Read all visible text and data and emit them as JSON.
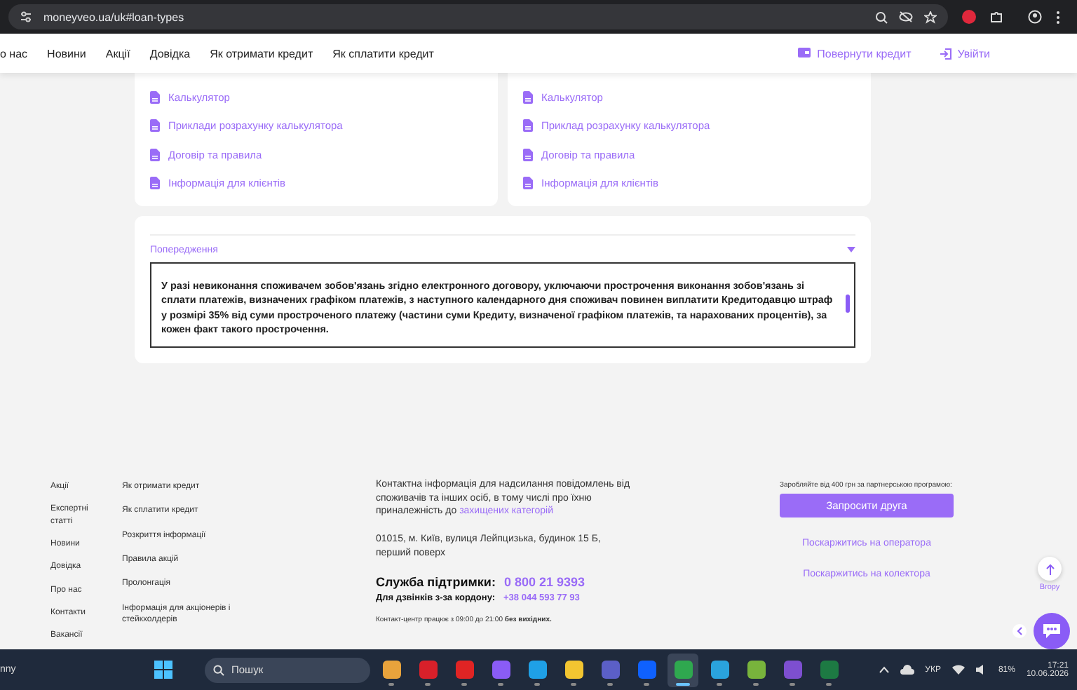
{
  "browser": {
    "url": "moneyveo.ua/uk#loan-types"
  },
  "nav": {
    "items": [
      "о нас",
      "Новини",
      "Акції",
      "Довідка",
      "Як отримати кредит",
      "Як сплатити кредит"
    ],
    "repay": "Повернути кредит",
    "login": "Увійти"
  },
  "cards": [
    {
      "links": [
        "Калькулятор",
        "Приклади розрахунку калькулятора",
        "Договір та правила",
        "Інформація для клієнтів"
      ]
    },
    {
      "links": [
        "Калькулятор",
        "Приклад розрахунку калькулятора",
        "Договір та правила",
        "Інформація для клієнтів"
      ]
    }
  ],
  "warning": {
    "title": "Попередження",
    "expanded": true,
    "text": "У разі невиконання споживачем зобов'язань згідно електронного договору, уключаючи прострочення виконання зобов'язань зі сплати платежів, визначених графіком платежів, з наступного календарного дня споживач повинен виплатити Кредитодавцю штраф у розмірі 35% від суми простроченого платежу (частини суми Кредиту, визначеної графіком платежів, та нарахованих процентів), за кожен факт такого прострочення."
  },
  "footer": {
    "column_1": [
      "Акції",
      "Експертні статті",
      "Новини",
      "Довідка",
      "Про нас",
      "Контакти",
      "Вакансії"
    ],
    "column_2": [
      "Як отримати кредит",
      "Як сплатити кредит",
      "Розкриття інформації",
      "Правила акцій",
      "Пролонгація",
      "Інформація для акціонерів і стейкхолдерів"
    ],
    "contact_text": "Контактна інформація для надсилання повідомлень від споживачів та інших осіб, в тому числі про їхню приналежність до ",
    "contact_link": "захищених категорій",
    "address": "01015, м. Київ, вулиця Лейпцизька, будинок 15 Б, перший поверх",
    "support_label": "Служба підтримки:",
    "support_phone": "0 800 21 9393",
    "abroad_label": "Для дзвінків з-за кордону:",
    "abroad_phone": "+38 044 593 77 93",
    "hours": "Контакт-центр працює з 09:00 до 21:00 **без вихідних.**",
    "partner_text": "Заробляйте від 400 грн за партнерською програмою:",
    "invite": "Запросити друга",
    "complaints": [
      "Поскаржитись на оператора",
      "Поскаржитись на колектора"
    ],
    "up_label": "Вгору"
  },
  "taskbar": {
    "left_text": "nny",
    "search": "Пошук",
    "apps": [
      {
        "color": "#e8a33c",
        "active": false
      },
      {
        "color": "#d8202a",
        "active": false
      },
      {
        "color": "#e02424",
        "active": false
      },
      {
        "color": "#8a5cf6",
        "active": false
      },
      {
        "color": "#1fa0e6",
        "active": false
      },
      {
        "color": "#f2c531",
        "active": false
      },
      {
        "color": "#5b5fc7",
        "active": false
      },
      {
        "color": "#0f61fe",
        "active": false
      },
      {
        "color": "#2fa84f",
        "active": true
      },
      {
        "color": "#2aa3dd",
        "active": false
      },
      {
        "color": "#78b43c",
        "active": false
      },
      {
        "color": "#7d4fd0",
        "active": false
      },
      {
        "color": "#1d7a43",
        "active": false
      }
    ],
    "lang": "УКР",
    "battery": "81%",
    "time": "17:21",
    "date": "10.06.2026"
  }
}
